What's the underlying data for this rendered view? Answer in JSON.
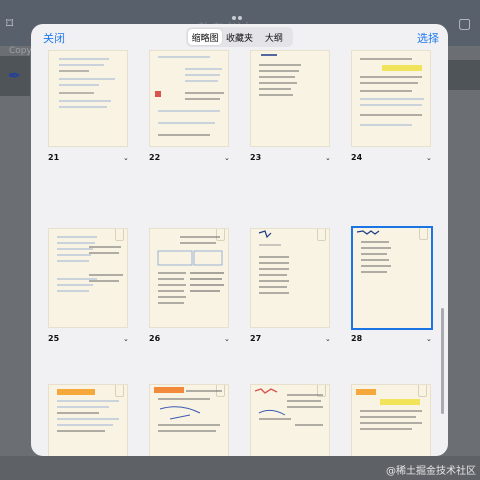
{
  "background_app": {
    "title": "软考必过",
    "copy_text": "Copy",
    "watermark": "@稀土掘金技术社区"
  },
  "sheet": {
    "close_label": "关闭",
    "select_label": "选择",
    "segments": [
      "缩略图",
      "收藏夹",
      "大纲"
    ],
    "active_segment": "缩略图",
    "selected_page": "28"
  },
  "thumbnails": {
    "row1": [
      "21",
      "22",
      "23",
      "24"
    ],
    "row2": [
      "25",
      "26",
      "27",
      "28"
    ],
    "row3": [
      "",
      "",
      "",
      ""
    ]
  },
  "colors": {
    "accent": "#1f7aeb",
    "page": "#f8f3e2",
    "selected_border": "#1b74e4"
  }
}
